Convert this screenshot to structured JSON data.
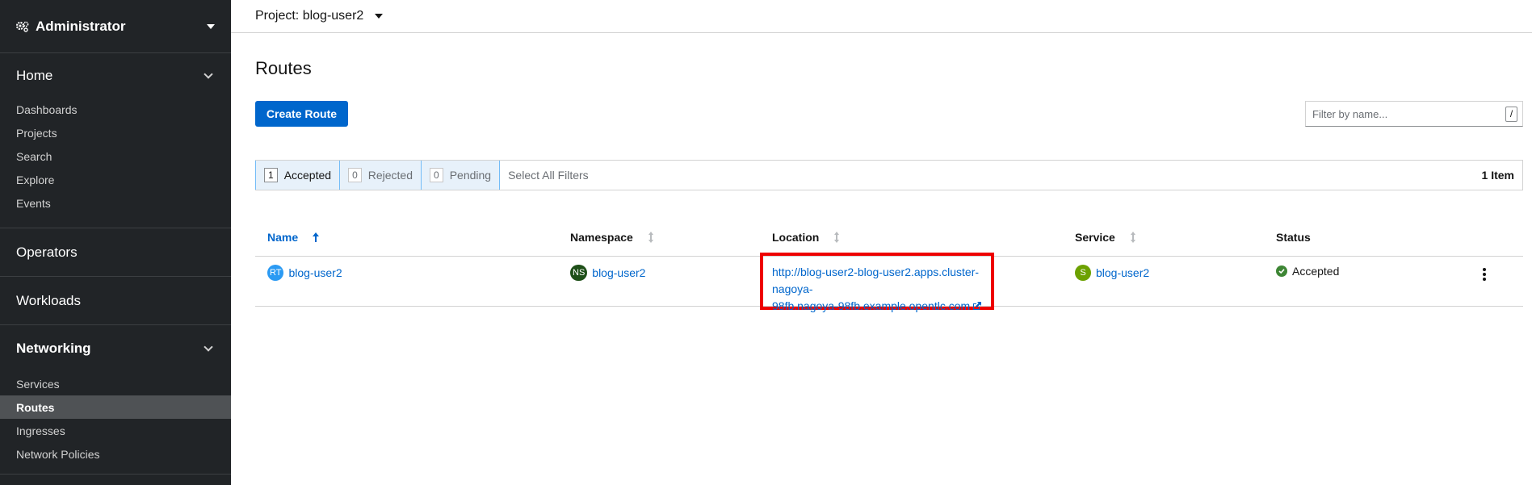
{
  "sidebar": {
    "perspective": "Administrator",
    "sections": {
      "home": {
        "label": "Home",
        "items": [
          "Dashboards",
          "Projects",
          "Search",
          "Explore",
          "Events"
        ]
      },
      "operators": {
        "label": "Operators"
      },
      "workloads": {
        "label": "Workloads"
      },
      "networking": {
        "label": "Networking",
        "items": [
          "Services",
          "Routes",
          "Ingresses",
          "Network Policies"
        ],
        "active": "Routes"
      }
    }
  },
  "header": {
    "project_label": "Project: blog-user2"
  },
  "page": {
    "title": "Routes",
    "create_button": "Create Route",
    "filter_placeholder": "Filter by name...",
    "filter_shortcut": "/"
  },
  "filters": {
    "chips": [
      {
        "count": "1",
        "label": "Accepted"
      },
      {
        "count": "0",
        "label": "Rejected"
      },
      {
        "count": "0",
        "label": "Pending"
      }
    ],
    "select_all": "Select All Filters",
    "item_count": "1 Item"
  },
  "table": {
    "columns": [
      "Name",
      "Namespace",
      "Location",
      "Service",
      "Status"
    ],
    "rows": [
      {
        "name_badge": "RT",
        "name": "blog-user2",
        "namespace_badge": "NS",
        "namespace": "blog-user2",
        "location_line1": "http://blog-user2-blog-user2.apps.cluster-nagoya-",
        "location_line2": "98fb.nagoya-98fb.example.opentlc.com",
        "service_badge": "S",
        "service": "blog-user2",
        "status": "Accepted"
      }
    ]
  },
  "colors": {
    "accent": "#0066cc",
    "sidebar_bg": "#212427",
    "highlight": "#ee0000",
    "success": "#3e8635"
  },
  "icons": [
    "gears-icon",
    "caret-down-icon",
    "chevron-down-icon",
    "sort-up-icon",
    "sort-icon",
    "external-link-icon",
    "check-circle-icon",
    "kebab-icon"
  ]
}
